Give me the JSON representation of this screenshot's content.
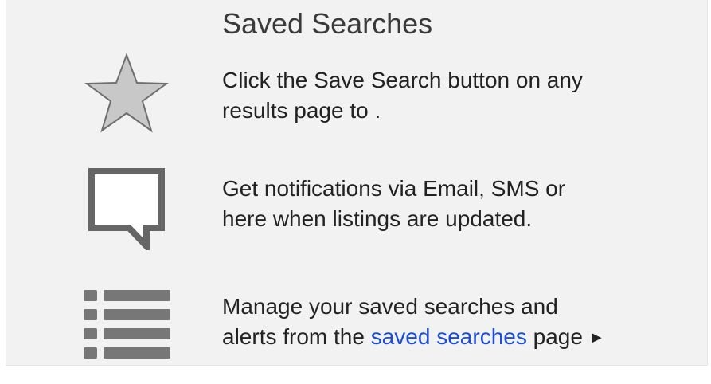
{
  "panel": {
    "title": "Saved Searches",
    "accent_link_color": "#1a4dd8",
    "items": [
      {
        "icon": "star-icon",
        "line1": "Click the Save Search button on any",
        "line2": "results page to ."
      },
      {
        "icon": "speech-bubble-icon",
        "line1": "Get notifications via Email, SMS or",
        "line2": "here when listings are updated."
      },
      {
        "icon": "list-icon",
        "line1": "Manage your saved searches and",
        "line2_prefix": "alerts from the",
        "link_text": "saved searches",
        "line2_suffix": "page",
        "arrow": "►"
      }
    ]
  }
}
